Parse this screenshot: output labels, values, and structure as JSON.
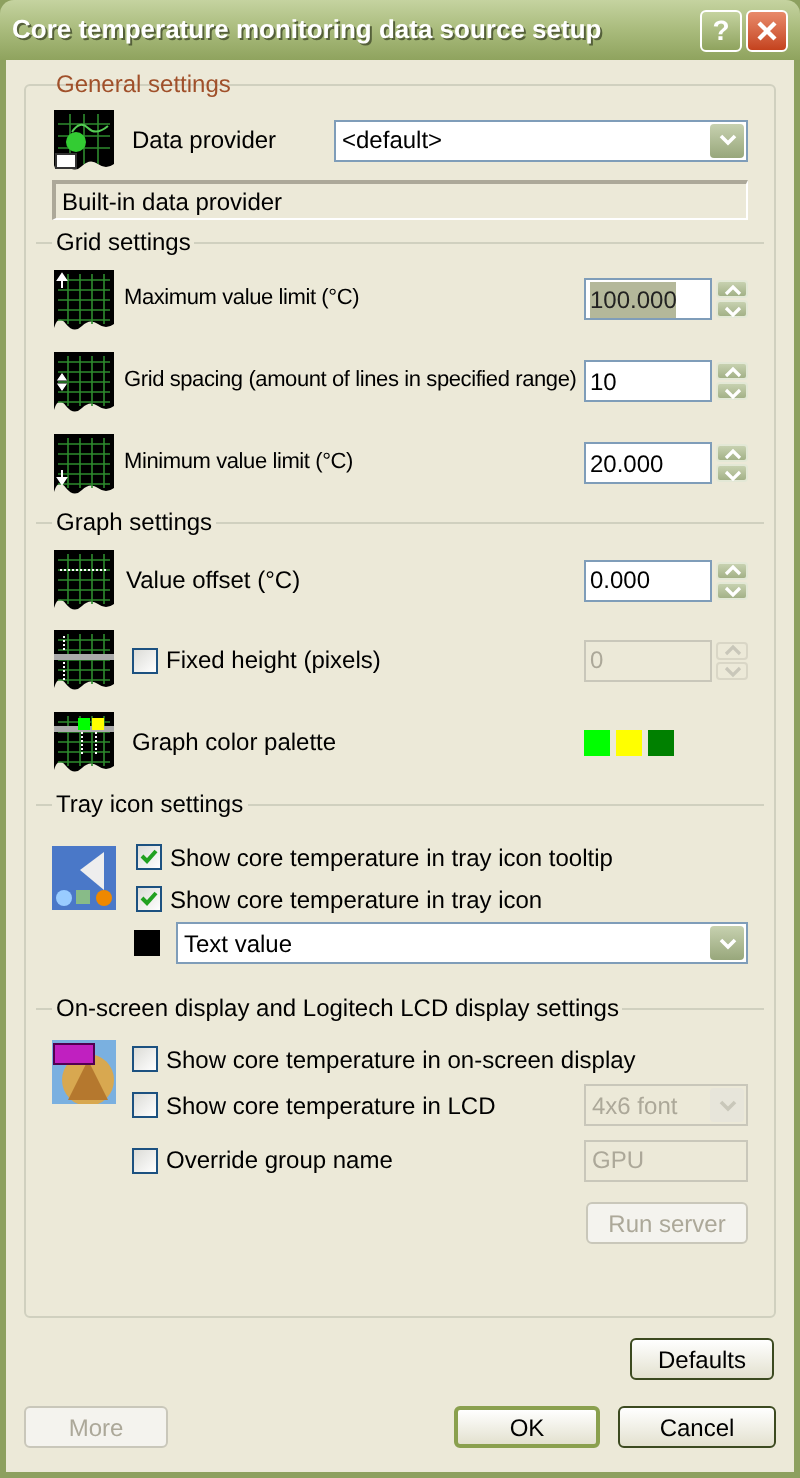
{
  "window": {
    "title": "Core temperature monitoring data source setup",
    "help": "?"
  },
  "general": {
    "title": "General settings",
    "provider_label": "Data provider",
    "provider_value": "<default>",
    "description": "Built-in data provider"
  },
  "grid": {
    "title": "Grid settings",
    "fields": [
      {
        "label": "Maximum value limit (°C)",
        "value": "100.000",
        "selected": true
      },
      {
        "label": "Grid spacing (amount of lines in specified range)",
        "value": "10",
        "selected": false
      },
      {
        "label": "Minimum value limit (°C)",
        "value": "20.000",
        "selected": false
      }
    ]
  },
  "graph": {
    "title": "Graph settings",
    "offset": {
      "label": "Value offset (°C)",
      "value": "0.000"
    },
    "fixed_height": {
      "label": "Fixed height (pixels)",
      "checked": false,
      "value": "0",
      "disabled": true
    },
    "palette": {
      "label": "Graph color palette",
      "colors": [
        {
          "color": "#00ff00"
        },
        {
          "color": "#ffff00"
        },
        {
          "color": "#008000"
        }
      ]
    }
  },
  "tray": {
    "title": "Tray icon settings",
    "options": [
      {
        "label": "Show core temperature in tray icon tooltip",
        "checked": true
      },
      {
        "label": "Show core temperature in tray icon",
        "checked": true
      }
    ],
    "mode_value": "Text value"
  },
  "osd": {
    "title": "On-screen display and Logitech LCD display settings",
    "osd_option": {
      "label": "Show core temperature in on-screen display",
      "checked": false
    },
    "lcd_option": {
      "label": "Show core temperature in LCD",
      "checked": false
    },
    "lcd_font": {
      "value": "4x6 font",
      "disabled": true
    },
    "override": {
      "label": "Override group name",
      "checked": false
    },
    "group_name": {
      "value": "GPU",
      "disabled": true
    },
    "run_server": {
      "label": "Run server",
      "disabled": true
    }
  },
  "buttons": {
    "defaults": "Defaults",
    "more": {
      "label": "More",
      "disabled": true
    },
    "ok": {
      "label": "OK",
      "default": true
    },
    "cancel": "Cancel"
  }
}
